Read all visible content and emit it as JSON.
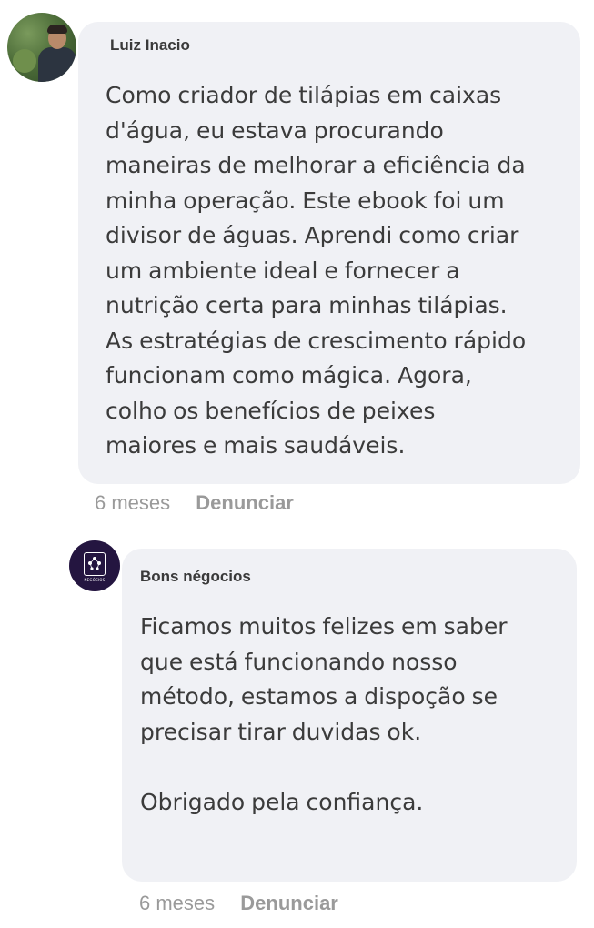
{
  "comments": [
    {
      "author": "Luiz Inacio",
      "text": "Como criador de tilápias em caixas\nd'água, eu estava procurando\nmaneiras de melhorar a eficiência da\nminha operação. Este ebook foi um\ndivisor de águas. Aprendi como criar\num ambiente ideal e fornecer a\nnutrição certa para minhas tilápias.\nAs estratégias de crescimento rápido\nfuncionam como mágica. Agora,\ncolho os benefícios de peixes\nmaiores e mais saudáveis.",
      "time": "6 meses",
      "report_label": "Denunciar"
    },
    {
      "author": "Bons négocios",
      "text": "Ficamos muitos felizes em saber\nque está funcionando nosso\nmétodo, estamos a dispoção se\nprecisar tirar duvidas ok.\n\nObrigado pela confiança.",
      "time": "6 meses",
      "report_label": "Denunciar",
      "avatar_logo_text": "NEGÓCIOS"
    }
  ],
  "colors": {
    "bubble_background": "#f0f1f5",
    "meta_text": "#9a9a9a",
    "logo_background": "#241540"
  }
}
